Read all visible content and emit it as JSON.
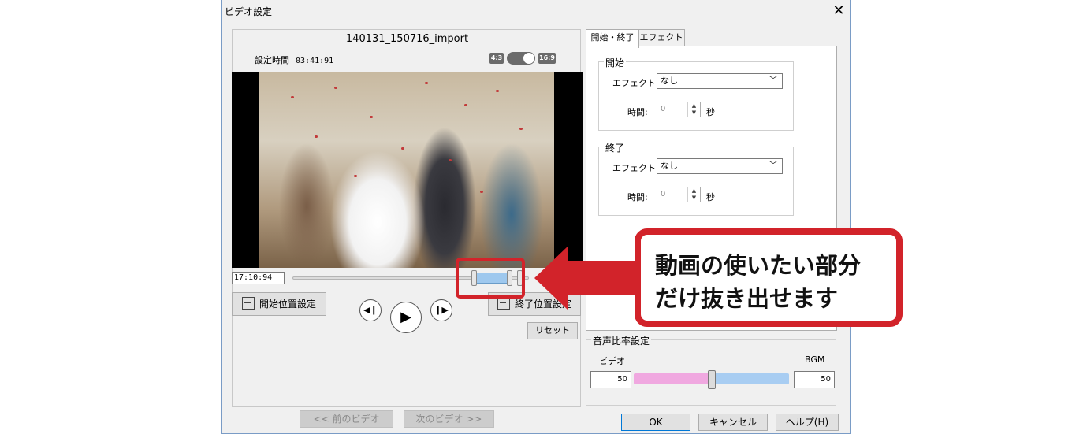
{
  "window": {
    "title": "ビデオ設定"
  },
  "preview": {
    "filename": "140131_150716_import",
    "set_time_label": "設定時間",
    "set_time_value": "03:41:91",
    "aspect_left": "4:3",
    "aspect_right": "16:9",
    "timecode": "17:10:94"
  },
  "buttons": {
    "start_position": "開始位置設定",
    "end_position": "終了位置設定",
    "reset": "リセット",
    "prev_video": "<< 前のビデオ",
    "next_video": "次のビデオ >>",
    "ok": "OK",
    "cancel": "キャンセル",
    "help": "ヘルプ(H)"
  },
  "tabs": [
    {
      "label": "開始・終了",
      "active": true
    },
    {
      "label": "エフェクト",
      "active": false
    }
  ],
  "start_group": {
    "title": "開始",
    "effect_label": "エフェクト:",
    "effect_value": "なし",
    "time_label": "時間:",
    "time_value": "0",
    "time_unit": "秒"
  },
  "end_group": {
    "title": "終了",
    "effect_label": "エフェクト:",
    "effect_value": "なし",
    "time_label": "時間:",
    "time_value": "0",
    "time_unit": "秒"
  },
  "audio": {
    "title": "音声比率設定",
    "left_label": "ビデオ",
    "right_label": "BGM",
    "left_value": "50",
    "right_value": "50",
    "balance": 0.5
  },
  "callout": {
    "line1": "動画の使いたい部分",
    "line2": "だけ抜き出せます",
    "color": "#d2232a"
  }
}
